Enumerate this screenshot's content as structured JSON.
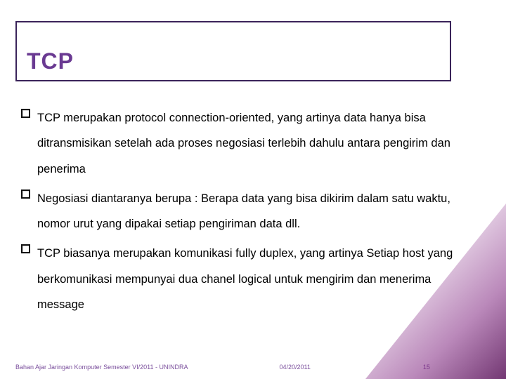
{
  "title": "TCP",
  "bullets": [
    "TCP merupakan protocol connection-oriented, yang artinya data hanya bisa ditransmisikan setelah ada proses negosiasi terlebih dahulu antara pengirim dan penerima",
    "Negosiasi diantaranya berupa : Berapa data yang bisa dikirim dalam satu waktu, nomor urut yang dipakai setiap pengiriman data dll.",
    "TCP biasanya merupakan komunikasi fully duplex, yang artinya Setiap host yang berkomunikasi mempunyai dua chanel logical untuk mengirim dan menerima message"
  ],
  "footer": {
    "source": "Bahan Ajar Jaringan Komputer Semester VI/2011 - UNINDRA",
    "date": "04/20/2011",
    "page": "15"
  }
}
